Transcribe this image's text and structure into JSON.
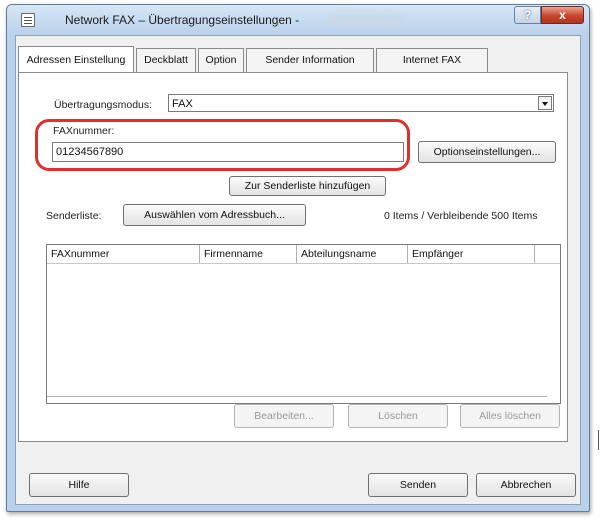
{
  "window": {
    "title": "Network FAX – Übertragungseinstellungen -",
    "help_label": "?",
    "close_label": "x"
  },
  "tabs": [
    {
      "label": "Adressen Einstellung",
      "active": true
    },
    {
      "label": "Deckblatt",
      "active": false
    },
    {
      "label": "Option",
      "active": false
    },
    {
      "label": "Sender Information",
      "active": false
    },
    {
      "label": "Internet FAX",
      "active": false
    }
  ],
  "form": {
    "mode_label": "Übertragungsmodus:",
    "mode_value": "FAX",
    "fax_label": "FAXnummer:",
    "fax_value": "01234567890",
    "options_button": "Optionseinstellungen...",
    "add_button": "Zur Senderliste hinzufügen",
    "senderlist_label": "Senderliste:",
    "addressbook_button": "Auswählen vom Adressbuch...",
    "items_status": "0 Items / Verbleibende 500 Items"
  },
  "list": {
    "columns": [
      "FAXnummer",
      "Firmenname",
      "Abteilungsname",
      "Empfänger"
    ],
    "rows": []
  },
  "list_buttons": {
    "edit": "Bearbeiten...",
    "delete": "Löschen",
    "delete_all": "Alles löschen"
  },
  "footer": {
    "help": "Hilfe",
    "send": "Senden",
    "cancel": "Abbrechen"
  },
  "colors": {
    "highlight": "#e0302e",
    "title_bar": "#b9d1ea",
    "close_button": "#c8452c"
  }
}
